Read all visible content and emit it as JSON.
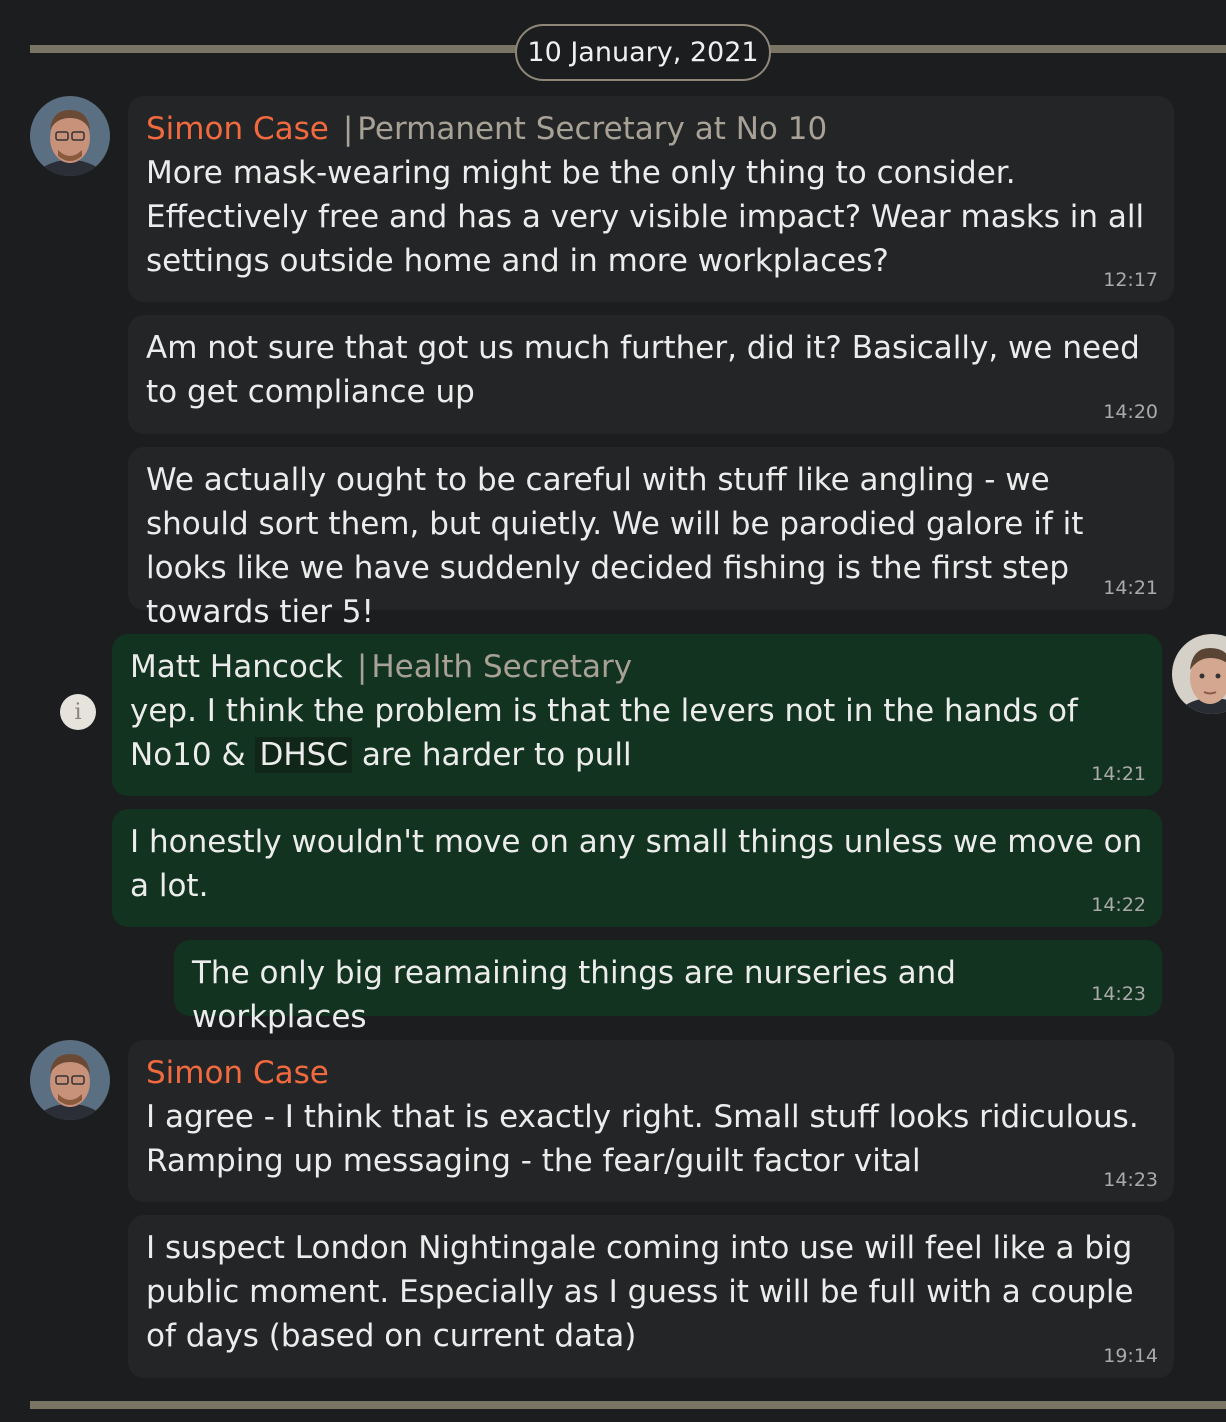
{
  "date_label": "10 January, 2021",
  "colors": {
    "incoming_bubble": "#242526",
    "outgoing_bubble": "#12331f",
    "case_name": "#f16a3f",
    "role": "#a7a196"
  },
  "messages": [
    {
      "sender": "Simon Case",
      "role": "Permanent Secretary at No 10",
      "text": "More mask-wearing might be the only thing to consider. Effectively free and has a very visible impact? Wear masks in all settings outside home and in more workplaces?",
      "time": "12:17"
    },
    {
      "text": "Am not sure that got us much further, did it? Basically, we need to get compliance up",
      "time": "14:20"
    },
    {
      "text": "We actually ought to be careful with stuff like angling - we should sort them, but quietly. We will be parodied galore if it looks like we have suddenly decided fishing is the first step towards tier 5!",
      "time": "14:21"
    },
    {
      "sender": "Matt Hancock",
      "role": "Health Secretary",
      "text_before": "yep. I think the problem is that the levers not in the hands of No10 & ",
      "highlight": "DHSC",
      "text_after": " are harder to pull",
      "time": "14:21"
    },
    {
      "text": "I honestly wouldn't move on any small things unless we move on a lot.",
      "time": "14:22"
    },
    {
      "text": "The only big reamaining things are nurseries and workplaces",
      "time": "14:23"
    },
    {
      "sender": "Simon Case",
      "text": "I agree - I think that is exactly right. Small stuff looks ridiculous. Ramping up messaging - the fear/guilt factor vital",
      "time": "14:23"
    },
    {
      "text": "I suspect London Nightingale coming into use will feel like a big public moment. Especially as I guess it will be full with a couple of days (based on current data)",
      "time": "19:14"
    }
  ],
  "info_icon": {
    "glyph": "i",
    "icon": "info-icon"
  }
}
